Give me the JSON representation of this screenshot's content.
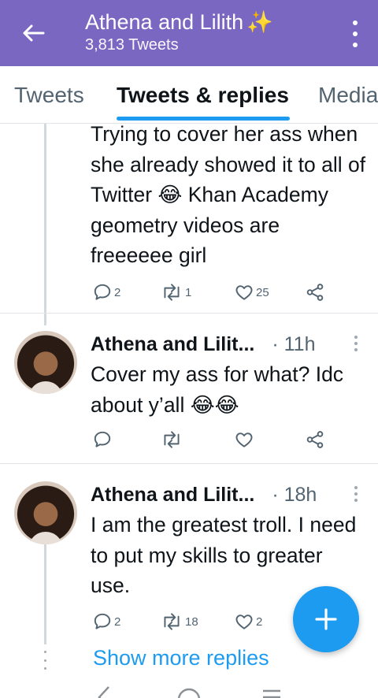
{
  "header": {
    "title": "Athena and Lilith",
    "title_emoji": "✨",
    "subtitle": "3,813 Tweets",
    "back_icon": "arrow-left-icon",
    "overflow_icon": "kebab-menu-icon"
  },
  "tabs": [
    {
      "label": "Tweets",
      "active": false
    },
    {
      "label": "Tweets & replies",
      "active": true
    },
    {
      "label": "Media",
      "active": false
    }
  ],
  "tweets": [
    {
      "text": "Trying to cover her ass when she already showed it to all of Twitter 😂 Khan Academy geometry videos are freeeeee girl",
      "reply_count": "2",
      "retweet_count": "1",
      "like_count": "25"
    },
    {
      "name": "Athena and Lilit...",
      "time": "· 11h",
      "text": "Cover my ass for what? Idc about y’all 😂😂",
      "reply_count": "",
      "retweet_count": "",
      "like_count": ""
    },
    {
      "name": "Athena and Lilit...",
      "time": "· 18h",
      "text": "I am the greatest troll. I need to put my skills to greater use.",
      "reply_count": "2",
      "retweet_count": "18",
      "like_count": "2"
    }
  ],
  "show_more": "Show more replies",
  "colors": {
    "appbar": "#7a67c2",
    "accent": "#1d9bf0",
    "muted": "#536471"
  }
}
